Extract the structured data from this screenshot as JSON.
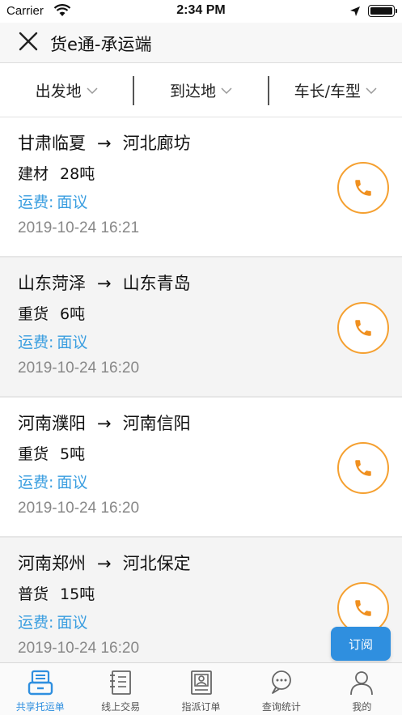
{
  "status": {
    "carrier": "Carrier",
    "time": "2:34 PM"
  },
  "nav": {
    "title": "货e通-承运端"
  },
  "filters": [
    {
      "label": "出发地"
    },
    {
      "label": "到达地"
    },
    {
      "label": "车长/车型"
    }
  ],
  "arrow": "→",
  "listings": [
    {
      "from": "甘肃临夏",
      "to": "河北廊坊",
      "cargo": "建材",
      "weight": "28吨",
      "fee_label": "运费:",
      "fee_value": "面议",
      "time": "2019-10-24 16:21"
    },
    {
      "from": "山东菏泽",
      "to": "山东青岛",
      "cargo": "重货",
      "weight": "6吨",
      "fee_label": "运费:",
      "fee_value": "面议",
      "time": "2019-10-24 16:20"
    },
    {
      "from": "河南濮阳",
      "to": "河南信阳",
      "cargo": "重货",
      "weight": "5吨",
      "fee_label": "运费:",
      "fee_value": "面议",
      "time": "2019-10-24 16:20"
    },
    {
      "from": "河南郑州",
      "to": "河北保定",
      "cargo": "普货",
      "weight": "15吨",
      "fee_label": "运费:",
      "fee_value": "面议",
      "time": "2019-10-24 16:20"
    }
  ],
  "subscribe_label": "订阅",
  "tabs": [
    {
      "label": "共享托运单",
      "icon": "shared-waybill-icon",
      "active": true
    },
    {
      "label": "线上交易",
      "icon": "online-trade-icon",
      "active": false
    },
    {
      "label": "指派订单",
      "icon": "assigned-order-icon",
      "active": false
    },
    {
      "label": "查询统计",
      "icon": "query-stats-icon",
      "active": false
    },
    {
      "label": "我的",
      "icon": "profile-icon",
      "active": false
    }
  ],
  "colors": {
    "accent": "#2f8fdf",
    "fee_text": "#3a9ee0",
    "phone_ring": "#f5a030",
    "time_text": "#888888"
  }
}
